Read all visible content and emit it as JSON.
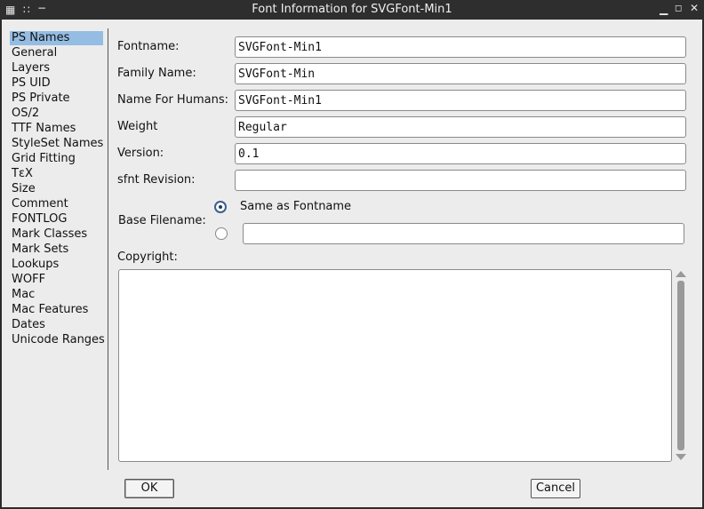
{
  "window": {
    "title": "Font Information for SVGFont-Min1"
  },
  "sidebar": {
    "items": [
      {
        "label": "PS Names",
        "selected": true
      },
      {
        "label": "General"
      },
      {
        "label": "Layers"
      },
      {
        "label": "PS UID"
      },
      {
        "label": "PS Private"
      },
      {
        "label": "OS/2"
      },
      {
        "label": "TTF Names"
      },
      {
        "label": "StyleSet Names"
      },
      {
        "label": "Grid Fitting"
      },
      {
        "label": "TεX"
      },
      {
        "label": "Size"
      },
      {
        "label": "Comment"
      },
      {
        "label": "FONTLOG"
      },
      {
        "label": "Mark Classes"
      },
      {
        "label": "Mark Sets"
      },
      {
        "label": "Lookups"
      },
      {
        "label": "WOFF"
      },
      {
        "label": "Mac"
      },
      {
        "label": "Mac Features"
      },
      {
        "label": "Dates"
      },
      {
        "label": "Unicode Ranges"
      }
    ]
  },
  "form": {
    "fontname": {
      "label": "Fontname:",
      "value": "SVGFont-Min1"
    },
    "family_name": {
      "label": "Family Name:",
      "value": "SVGFont-Min"
    },
    "name_for_humans": {
      "label": "Name For Humans:",
      "value": "SVGFont-Min1"
    },
    "weight": {
      "label": "Weight",
      "value": "Regular"
    },
    "version": {
      "label": "Version:",
      "value": "0.1"
    },
    "sfnt_revision": {
      "label": "sfnt Revision:",
      "value": ""
    },
    "base_filename": {
      "label": "Base Filename:",
      "option_same": "Same as Fontname",
      "selected": "same",
      "custom_value": ""
    },
    "copyright": {
      "label": "Copyright:",
      "value": ""
    }
  },
  "buttons": {
    "ok": "OK",
    "cancel": "Cancel"
  },
  "colors": {
    "selection": "#95bde3",
    "titlebar": "#2e2e2e",
    "dialog_bg": "#ececec"
  }
}
